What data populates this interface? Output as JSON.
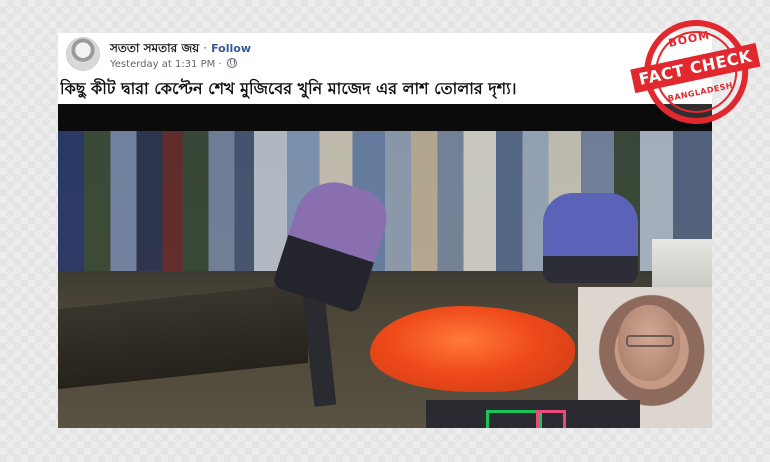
{
  "post": {
    "author": "সততা সমতার জয়",
    "separator": "·",
    "follow_label": "Follow",
    "timestamp": "Yesterday at 1:31 PM ·",
    "caption": "কিছু কীট দ্বারা কেপ্টেন শেখ মুজিবের খুনি মাজেদ এর লাশ তোলার দৃশ্য।"
  },
  "stamp": {
    "top_text": "BOOM",
    "banner_text": "FACT CHECK",
    "bottom_text": "BANGLADESH"
  },
  "colors": {
    "stamp_red": "#e0282e",
    "follow_blue": "#385898",
    "bag_orange": "#ef4a1b"
  },
  "icons": {
    "privacy": "globe-icon"
  }
}
